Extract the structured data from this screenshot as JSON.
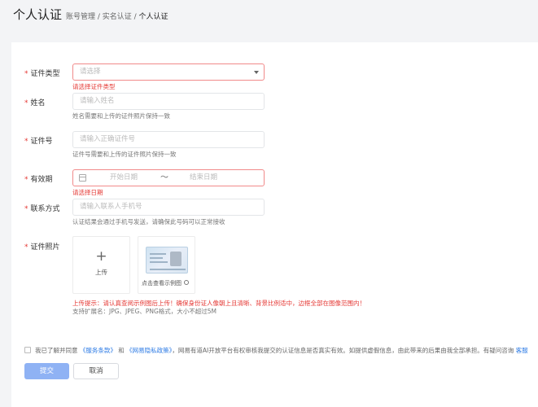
{
  "header": {
    "title": "个人认证",
    "breadcrumb": {
      "part1": "账号管理 / 实名认证 / ",
      "current": "个人认证"
    }
  },
  "form": {
    "id_type": {
      "required": "*",
      "label": "证件类型",
      "placeholder": "请选择",
      "error": "请选择证件类型"
    },
    "name": {
      "required": "*",
      "label": "姓名",
      "placeholder": "请输入姓名",
      "hint": "姓名需要和上传的证件照片保持一致"
    },
    "id_number": {
      "required": "*",
      "label": "证件号",
      "placeholder": "请输入正确证件号",
      "hint": "证件号需要和上传的证件照片保持一致"
    },
    "validity": {
      "required": "*",
      "label": "有效期",
      "start_placeholder": "开始日期",
      "separator": "～",
      "end_placeholder": "结束日期",
      "error": "请选择日期"
    },
    "contact": {
      "required": "*",
      "label": "联系方式",
      "placeholder": "请输入联系人手机号",
      "hint": "认证结果会通过手机号发送，请确保此号码可以正常接收"
    },
    "photo": {
      "required": "*",
      "label": "证件照片",
      "upload_icon": "+",
      "upload_label": "上传",
      "sample_label": "点击查看示例图",
      "warning": "上传提示：请认真查阅示例图后上传！确保身份证人像朝上且清晰、背景比例适中，边框全部在图像范围内！",
      "formats": "支持扩展名：JPG、JPEG、PNG格式，大小不超过5M"
    }
  },
  "agreement": {
    "text1": "我已了解并同意",
    "terms": "《服务条款》",
    "and": " 和 ",
    "privacy": "《网易隐私政策》",
    "text2": "，网易有道AI开放平台有权审核我提交的认证信息是否真实有效。如提供虚假信息，由此带来的后果由我全部承担。有疑问咨询",
    "support": "客服"
  },
  "buttons": {
    "submit": "提交",
    "cancel": "取消"
  },
  "colors": {
    "error": "#e53935",
    "link": "#2d7be5",
    "primary_disabled": "#8fb2f4"
  }
}
